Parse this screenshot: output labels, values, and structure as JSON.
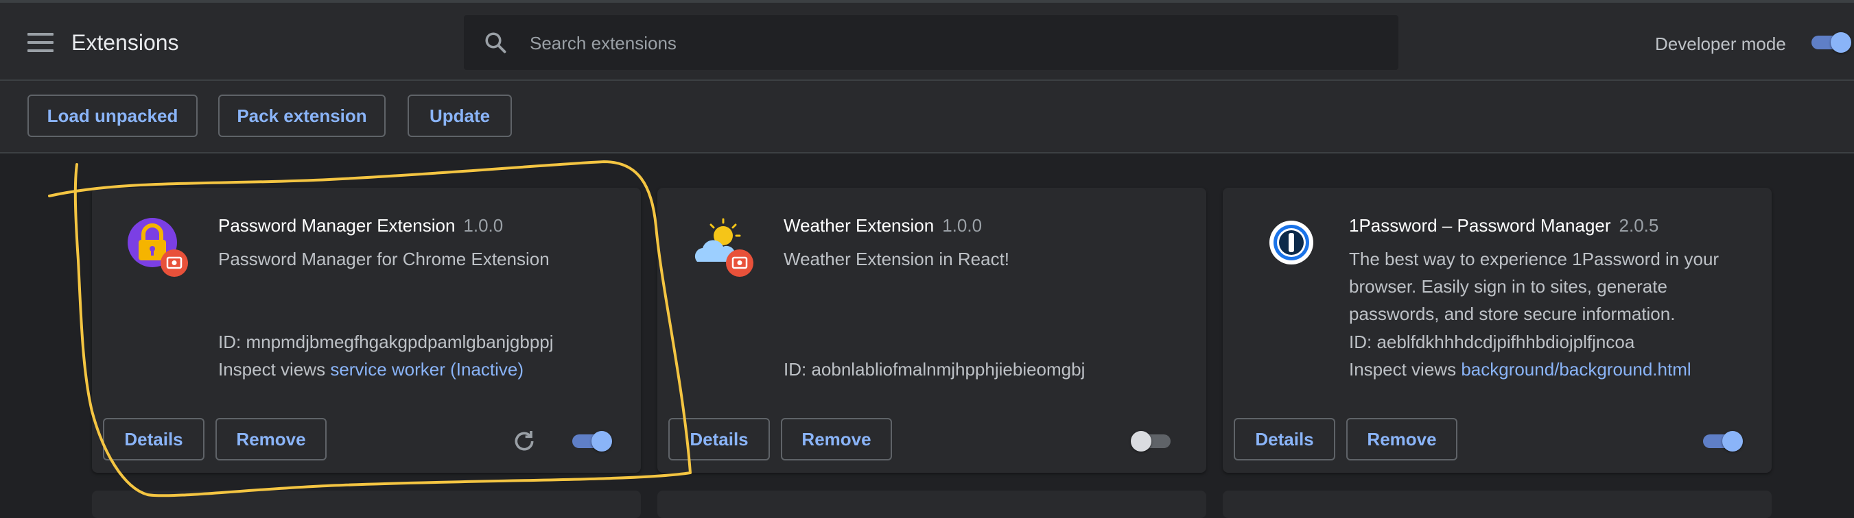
{
  "header": {
    "title": "Extensions",
    "search_placeholder": "Search extensions",
    "developer_mode_label": "Developer mode",
    "developer_mode_on": true
  },
  "toolbar": {
    "load_unpacked": "Load unpacked",
    "pack_extension": "Pack extension",
    "update": "Update"
  },
  "extensions": [
    {
      "name": "Password Manager Extension",
      "version": "1.0.0",
      "description": "Password Manager for Chrome Extension",
      "id_line": "ID: mnpmdjbmegfhgakgpdpamlgbanjgbppj",
      "inspect_label": "Inspect views",
      "inspect_link": "service worker (Inactive)",
      "details": "Details",
      "remove": "Remove",
      "enabled": true,
      "icon": "lock-icon"
    },
    {
      "name": "Weather Extension",
      "version": "1.0.0",
      "description": "Weather Extension in React!",
      "id_line": "ID: aobnlabliofmalnmjhpphjiebieomgbj",
      "details": "Details",
      "remove": "Remove",
      "enabled": false,
      "icon": "weather-icon"
    },
    {
      "name": "1Password – Password Manager",
      "version": "2.0.5",
      "description": "The best way to experience 1Password in your browser. Easily sign in to sites, generate passwords, and store secure information.",
      "id_line": "ID: aeblfdkhhhdcdjpifhhbdiojplfjncoa",
      "inspect_label": "Inspect views",
      "inspect_link": "background/background.html",
      "details": "Details",
      "remove": "Remove",
      "enabled": true,
      "icon": "1password-icon"
    }
  ],
  "colors": {
    "background": "#202124",
    "surface": "#292a2d",
    "accent": "#8ab4f8",
    "annotation": "#f4c542"
  }
}
